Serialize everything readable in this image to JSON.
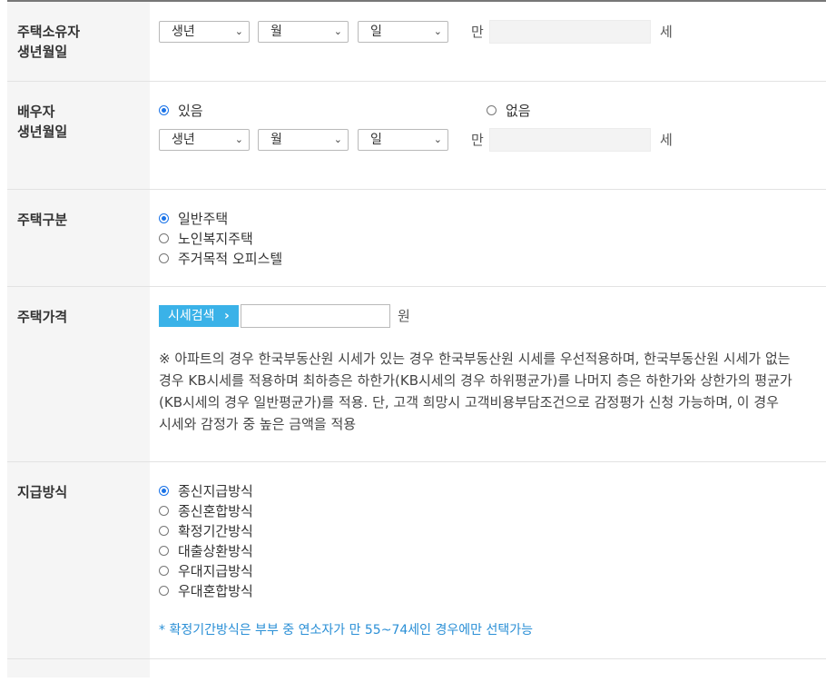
{
  "owner_birth": {
    "label_line1": "주택소유자",
    "label_line2": "생년월일",
    "year": "생년",
    "month": "월",
    "day": "일",
    "age_prefix": "만",
    "age_suffix": "세"
  },
  "spouse_birth": {
    "label_line1": "배우자",
    "label_line2": "생년월일",
    "option_yes": "있음",
    "option_no": "없음",
    "year": "생년",
    "month": "월",
    "day": "일",
    "age_prefix": "만",
    "age_suffix": "세"
  },
  "house_type": {
    "label": "주택구분",
    "options": [
      "일반주택",
      "노인복지주택",
      "주거목적 오피스텔"
    ]
  },
  "house_price": {
    "label": "주택가격",
    "search_button": "시세검색",
    "search_chevron": "›",
    "unit": "원",
    "note_lines": [
      "※ 아파트의 경우 한국부동산원 시세가 있는 경우 한국부동산원 시세를 우선적용하며, 한국부동산원 시세가 없는",
      "경우 KB시세를 적용하며 최하층은 하한가(KB시세의 경우 하위평균가)를 나머지 층은 하한가와 상한가의 평균가",
      "(KB시세의 경우 일반평균가)를 적용. 단, 고객 희망시 고객비용부담조건으로 감정평가 신청 가능하며, 이 경우",
      "시세와 감정가 중 높은 금액을 적용"
    ]
  },
  "payment_method": {
    "label": "지급방식",
    "options": [
      "종신지급방식",
      "종신혼합방식",
      "확정기간방식",
      "대출상환방식",
      "우대지급방식",
      "우대혼합방식"
    ],
    "note": "* 확정기간방식은 부부 중 연소자가 만 55~74세인 경우에만 선택가능"
  },
  "colors": {
    "accent": "#3ab2e8",
    "radio_selected": "#1a73e8",
    "note_blue": "#2a8fd6",
    "header_bg": "#f5f5f5"
  }
}
